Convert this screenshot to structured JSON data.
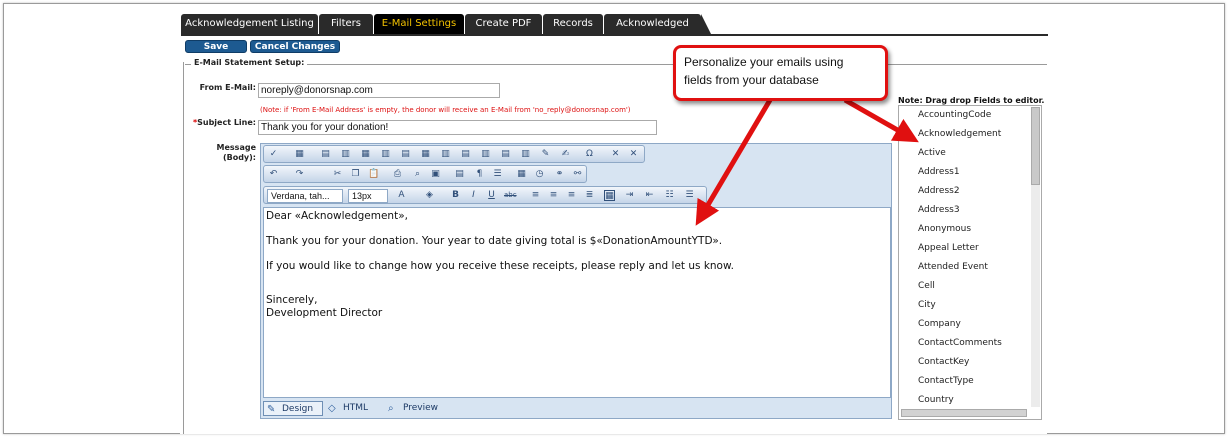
{
  "tabs": [
    {
      "label": "Acknowledgement Listing"
    },
    {
      "label": "Filters"
    },
    {
      "label": "E-Mail Settings"
    },
    {
      "label": "Create PDF"
    },
    {
      "label": "Records"
    },
    {
      "label": "Acknowledged"
    }
  ],
  "active_tab": "E-Mail Settings",
  "buttons": {
    "save": "Save",
    "cancel": "Cancel Changes"
  },
  "section_title": "E-Mail Statement Setup:",
  "from": {
    "label": "From E-Mail:",
    "value": "noreply@donorsnap.com",
    "note": "(Note: if 'From E-Mail Address' is empty, the donor will receive an E-Mail from 'no_reply@donorsnap.com')"
  },
  "subject": {
    "required_mark": "*",
    "label": "Subject Line:",
    "value": "Thank you for your donation!"
  },
  "message": {
    "label_line1": "Message",
    "label_line2": "(Body):"
  },
  "editor": {
    "font_select": "Verdana, tah...",
    "size_select": "13px",
    "body": {
      "line1": "Dear «Acknowledgement»,",
      "line2": "Thank you for your donation. Your year to date giving total is $«DonationAmountYTD».",
      "line3": "If you would like to change how you receive these receipts, please reply and let us know.",
      "line4": "Sincerely,",
      "line5": "Development Director"
    },
    "modes": {
      "design": "Design",
      "html": "HTML",
      "preview": "Preview"
    }
  },
  "callout": {
    "line1": "Personalize your emails using",
    "line2": "fields from your database"
  },
  "fields_note": "Note: Drag drop Fields to editor.",
  "fields": [
    "AccountingCode",
    "Acknowledgement",
    "Active",
    "Address1",
    "Address2",
    "Address3",
    "Anonymous",
    "Appeal Letter",
    "Attended Event",
    "Cell",
    "City",
    "Company",
    "ContactComments",
    "ContactKey",
    "ContactType",
    "Country"
  ],
  "colors": {
    "tab_bg": "#2a2a2a",
    "tab_active_text": "#f3c200",
    "button_bg": "#1d5a91",
    "callout_border": "#e01010",
    "arrow": "#e01010",
    "note_text": "#d11111"
  },
  "icons": [
    "spellcheck-icon",
    "table-icon",
    "undo-icon",
    "redo-icon",
    "cut-icon",
    "copy-icon",
    "paste-icon",
    "print-icon",
    "find-icon",
    "bold-icon",
    "italic-icon",
    "underline-icon",
    "strike-icon",
    "align-left-icon",
    "align-center-icon",
    "align-right-icon",
    "justify-icon",
    "indent-icon",
    "outdent-icon",
    "ordered-list-icon",
    "bullet-list-icon",
    "special-char-icon",
    "design-pencil-icon",
    "html-code-icon",
    "preview-magnifier-icon"
  ]
}
